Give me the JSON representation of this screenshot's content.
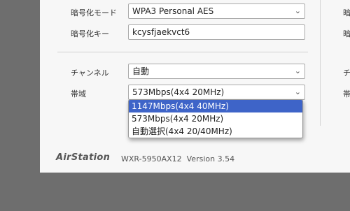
{
  "settings": {
    "encryption_mode": {
      "label": "暗号化モード",
      "value": "WPA3 Personal AES"
    },
    "encryption_key": {
      "label": "暗号化キー",
      "value": "kcysfjaekvct6"
    },
    "channel": {
      "label": "チャンネル",
      "value": "自動"
    },
    "bandwidth": {
      "label": "帯域",
      "value": "573Mbps(4x4 20MHz)"
    }
  },
  "dropdown": {
    "options": [
      "1147Mbps(4x4 40MHz)",
      "573Mbps(4x4 20MHz)",
      "自動選択(4x4 20/40MHz)"
    ],
    "highlighted_index": 0
  },
  "right_edge_glyphs": [
    "暗",
    "暗",
    "チ",
    "帯"
  ],
  "footer": {
    "brand": "AirStation",
    "model": "WXR-5950AX12",
    "version": "Version 3.54"
  },
  "colors": {
    "highlight": "#3e64c8",
    "panel": "#f7f7f7",
    "backdrop": "#6e6e6e"
  }
}
